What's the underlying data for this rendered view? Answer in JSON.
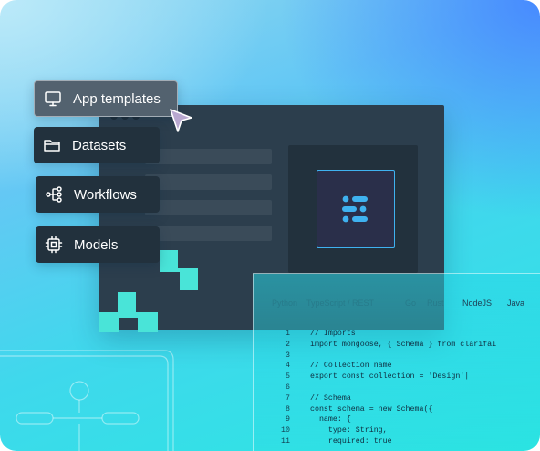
{
  "menu": {
    "items": [
      {
        "label": "App templates",
        "icon": "monitor-icon",
        "active": true
      },
      {
        "label": "Datasets",
        "icon": "folder-icon",
        "active": false
      },
      {
        "label": "Workflows",
        "icon": "workflow-icon",
        "active": false
      },
      {
        "label": "Models",
        "icon": "chip-icon",
        "active": false
      }
    ]
  },
  "code_panel": {
    "tabs": [
      {
        "label": "Python",
        "faded": true
      },
      {
        "label": "TypeScript / REST",
        "faded": true
      },
      {
        "label": "Go",
        "faded": true
      },
      {
        "label": "Rust",
        "faded": true
      },
      {
        "label": "NodeJS",
        "faded": false
      },
      {
        "label": "Java",
        "faded": false
      }
    ],
    "lines": [
      {
        "num": "1",
        "code": "// Imports"
      },
      {
        "num": "2",
        "code": "import mongoose, { Schema } from clarifai"
      },
      {
        "num": "3",
        "code": ""
      },
      {
        "num": "4",
        "code": "// Collection name"
      },
      {
        "num": "5",
        "code": "export const collection = 'Design'|"
      },
      {
        "num": "6",
        "code": ""
      },
      {
        "num": "7",
        "code": "// Schema"
      },
      {
        "num": "8",
        "code": "const schema = new Schema({"
      },
      {
        "num": "9",
        "code": "  name: {"
      },
      {
        "num": "10",
        "code": "    type: String,"
      },
      {
        "num": "11",
        "code": "    required: true"
      }
    ]
  },
  "colors": {
    "window": "#2c3e4d",
    "accent_teal": "#49e4d8",
    "logo_blue": "#3fb2f0"
  }
}
